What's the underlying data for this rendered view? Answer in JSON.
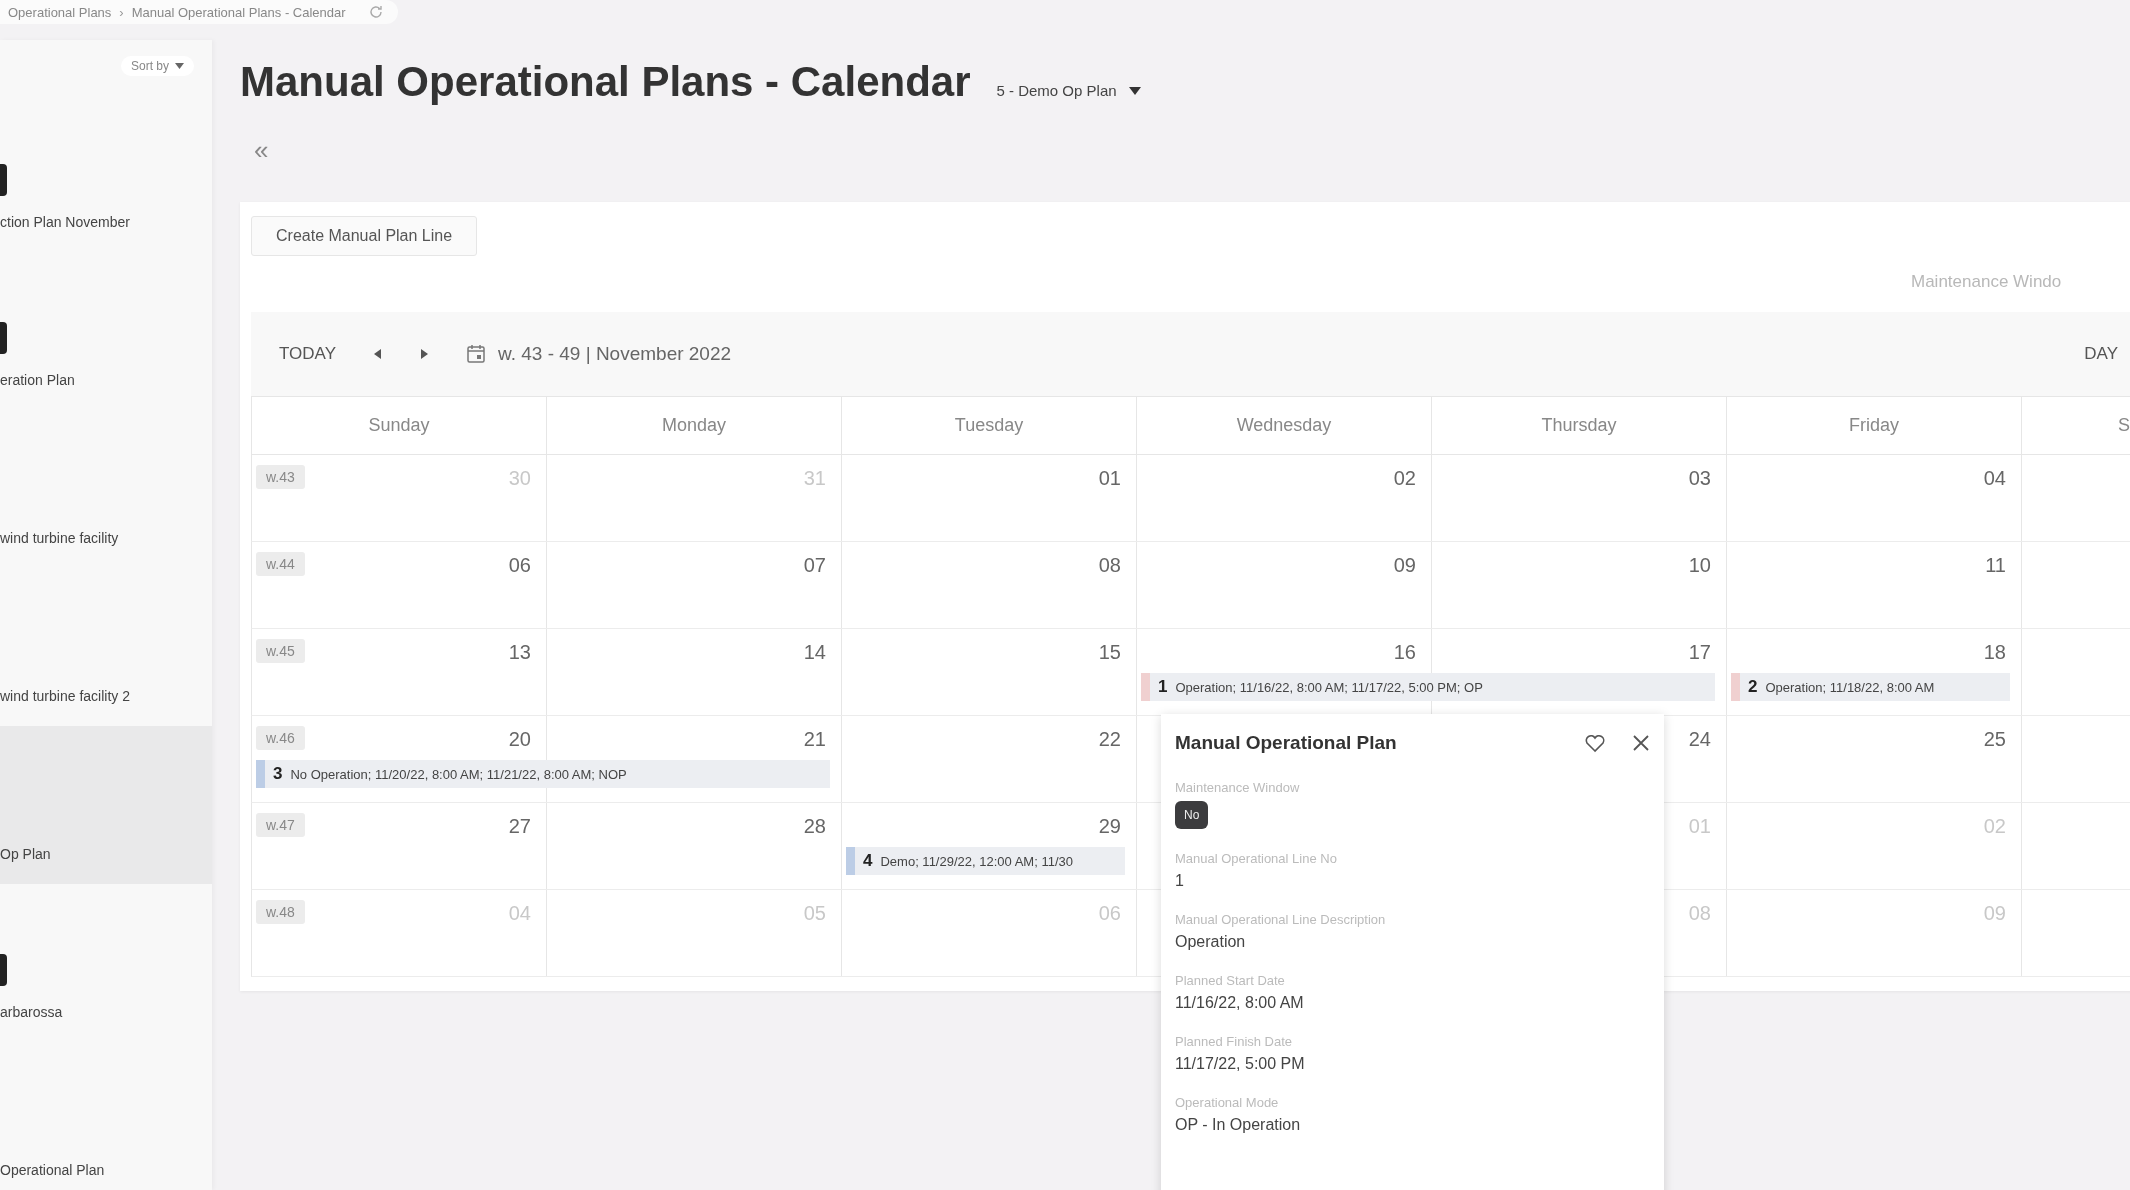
{
  "breadcrumb": {
    "items": [
      "Operational Plans",
      "Manual Operational Plans - Calendar"
    ],
    "separator": "›"
  },
  "sidebar": {
    "sort_label": "Sort by",
    "items": [
      {
        "label": "ction Plan November",
        "marker": true,
        "selected": false
      },
      {
        "label": "eration Plan",
        "marker": true,
        "selected": false
      },
      {
        "label": "wind turbine facility",
        "marker": false,
        "selected": false
      },
      {
        "label": "wind turbine facility 2",
        "marker": false,
        "selected": false
      },
      {
        "label": "Op Plan",
        "marker": false,
        "selected": true
      },
      {
        "label": "arbarossa",
        "marker": true,
        "selected": false
      },
      {
        "label": "Operational Plan",
        "marker": false,
        "selected": false
      }
    ]
  },
  "title": "Manual Operational Plans - Calendar",
  "plan_selector": "5 - Demo Op Plan",
  "collapse": "«",
  "create_button": "Create Manual Plan Line",
  "maintenance_label": "Maintenance Windo",
  "toolbar": {
    "today": "TODAY",
    "range": "w. 43 - 49 | November 2022",
    "view": "DAY"
  },
  "day_headers": [
    "Sunday",
    "Monday",
    "Tuesday",
    "Wednesday",
    "Thursday",
    "Friday",
    "S"
  ],
  "weeks": [
    {
      "label": "w.43",
      "days": {
        "sun": {
          "date": "30",
          "muted": true
        },
        "mon": {
          "date": "31",
          "muted": true
        },
        "tue": {
          "date": "01",
          "muted": false
        },
        "wed": {
          "date": "02",
          "muted": false
        },
        "thu": {
          "date": "03",
          "muted": false
        },
        "fri": {
          "date": "04",
          "muted": false
        }
      }
    },
    {
      "label": "w.44",
      "days": {
        "sun": {
          "date": "06",
          "muted": false
        },
        "mon": {
          "date": "07",
          "muted": false
        },
        "tue": {
          "date": "08",
          "muted": false
        },
        "wed": {
          "date": "09",
          "muted": false
        },
        "thu": {
          "date": "10",
          "muted": false
        },
        "fri": {
          "date": "11",
          "muted": false
        }
      }
    },
    {
      "label": "w.45",
      "days": {
        "sun": {
          "date": "13",
          "muted": false
        },
        "mon": {
          "date": "14",
          "muted": false
        },
        "tue": {
          "date": "15",
          "muted": false
        },
        "wed": {
          "date": "16",
          "muted": false,
          "event": {
            "number": "1",
            "text": "Operation; 11/16/22, 8:00 AM; 11/17/22, 5:00 PM; OP",
            "multi_day": true,
            "color": "#f0d0d0"
          }
        },
        "thu": {
          "date": "17",
          "muted": false
        },
        "fri": {
          "date": "18",
          "muted": false,
          "event": {
            "number": "2",
            "text": "Operation; 11/18/22, 8:00 AM",
            "multi_day": false,
            "color": "#f0d0d0"
          }
        }
      }
    },
    {
      "label": "w.46",
      "days": {
        "sun": {
          "date": "20",
          "muted": false,
          "event": {
            "number": "3",
            "text": "No Operation; 11/20/22, 8:00 AM; 11/21/22, 8:00 AM; NOP",
            "multi_day": true,
            "color": "#bccde6"
          }
        },
        "mon": {
          "date": "21",
          "muted": false
        },
        "tue": {
          "date": "22",
          "muted": false
        },
        "thu": {
          "date": "24",
          "muted": false
        },
        "fri": {
          "date": "25",
          "muted": false
        }
      }
    },
    {
      "label": "w.47",
      "days": {
        "sun": {
          "date": "27",
          "muted": false
        },
        "mon": {
          "date": "28",
          "muted": false
        },
        "tue": {
          "date": "29",
          "muted": false,
          "event": {
            "number": "4",
            "text": "Demo; 11/29/22, 12:00 AM; 11/30",
            "multi_day": false,
            "color": "#bccde6"
          }
        },
        "thu": {
          "date": "01",
          "muted": true
        },
        "fri": {
          "date": "02",
          "muted": true
        }
      }
    },
    {
      "label": "w.48",
      "days": {
        "sun": {
          "date": "04",
          "muted": true
        },
        "mon": {
          "date": "05",
          "muted": true
        },
        "tue": {
          "date": "06",
          "muted": true
        },
        "thu": {
          "date": "08",
          "muted": true
        },
        "fri": {
          "date": "09",
          "muted": true
        }
      }
    }
  ],
  "popup": {
    "title": "Manual Operational Plan",
    "fields": [
      {
        "label": "Maintenance Window",
        "value": "No",
        "kind": "badge"
      },
      {
        "label": "Manual Operational Line No",
        "value": "1",
        "kind": "text"
      },
      {
        "label": "Manual Operational Line Description",
        "value": "Operation",
        "kind": "text"
      },
      {
        "label": "Planned Start Date",
        "value": "11/16/22, 8:00 AM",
        "kind": "text"
      },
      {
        "label": "Planned Finish Date",
        "value": "11/17/22, 5:00 PM",
        "kind": "text"
      },
      {
        "label": "Operational Mode",
        "value": "OP - In Operation",
        "kind": "text"
      }
    ]
  }
}
